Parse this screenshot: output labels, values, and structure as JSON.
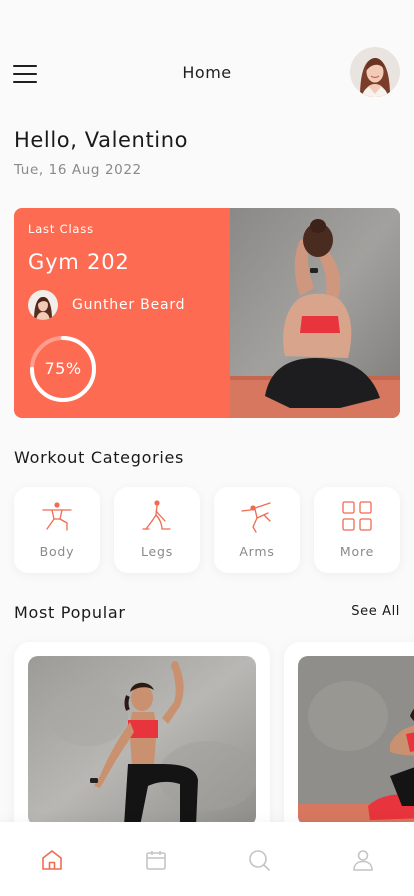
{
  "header": {
    "title": "Home",
    "menu_icon": "hamburger-menu-icon",
    "avatar": "user-avatar"
  },
  "greeting": {
    "hello": "Hello, Valentino",
    "date": "Tue, 16 Aug 2022"
  },
  "last_class": {
    "label": "Last Class",
    "name": "Gym 202",
    "coach": "Gunther Beard",
    "progress_text": "75%",
    "progress": 0.75
  },
  "categories": {
    "title": "Workout Categories",
    "items": [
      {
        "label": "Body",
        "icon": "body-pose-icon"
      },
      {
        "label": "Legs",
        "icon": "legs-pose-icon"
      },
      {
        "label": "Arms",
        "icon": "arms-pose-icon"
      },
      {
        "label": "More",
        "icon": "grid-icon"
      }
    ]
  },
  "popular": {
    "title": "Most Popular",
    "see_all": "See All"
  },
  "bottom_nav": {
    "items": [
      "home-icon",
      "calendar-icon",
      "search-icon",
      "profile-icon"
    ],
    "active": "home-icon"
  },
  "colors": {
    "accent": "#fd6b52",
    "text": "#1f1f1f",
    "muted": "#8a8a8a",
    "nav_inactive": "#c4c4c4"
  }
}
